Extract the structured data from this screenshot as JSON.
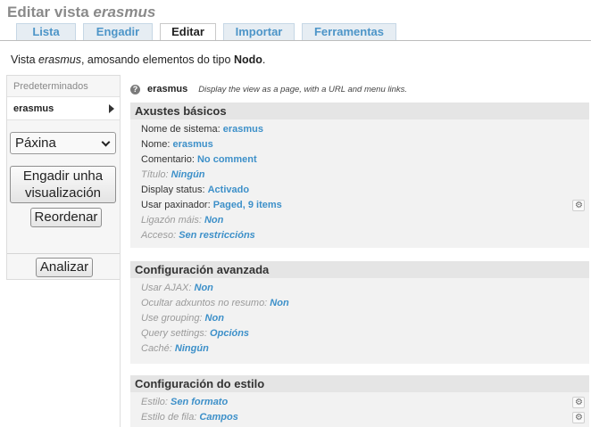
{
  "header": {
    "title_prefix": "Editar vista ",
    "title_view": "erasmus"
  },
  "tabs": [
    {
      "label": "Lista",
      "active": false
    },
    {
      "label": "Engadir",
      "active": false
    },
    {
      "label": "Editar",
      "active": true
    },
    {
      "label": "Importar",
      "active": false
    },
    {
      "label": "Ferramentas",
      "active": false
    }
  ],
  "description": {
    "prefix": "Vista ",
    "view": "erasmus",
    "middle": ", amosando elementos do tipo ",
    "type": "Nodo",
    "suffix": "."
  },
  "sidebar": {
    "tabs": [
      "Predeterminados",
      "erasmus"
    ],
    "display_select": "Páxina",
    "add_button": "Engadir unha visualización",
    "reorder_button": "Reordenar",
    "analyze_button": "Analizar"
  },
  "view_header": {
    "name": "erasmus",
    "desc": "Display the view as a page, with a URL and menu links."
  },
  "sections": {
    "basic": {
      "title": "Axustes básicos",
      "rows": [
        {
          "label": "Nome de sistema: ",
          "value": "erasmus"
        },
        {
          "label": "Nome: ",
          "value": "erasmus"
        },
        {
          "label": "Comentario: ",
          "value": "No comment"
        },
        {
          "label": "Título: ",
          "value": "Ningún"
        },
        {
          "label": "Display status: ",
          "value": "Activado"
        },
        {
          "label": "Usar paxinador: ",
          "value": "Paged, 9 items"
        },
        {
          "label": "Ligazón máis: ",
          "value": "Non"
        },
        {
          "label": "Acceso: ",
          "value": "Sen restriccións"
        }
      ]
    },
    "advanced": {
      "title": "Configuración avanzada",
      "rows": [
        {
          "label": "Usar AJAX: ",
          "value": "Non"
        },
        {
          "label": "Ocultar adxuntos no resumo: ",
          "value": "Non"
        },
        {
          "label": "Use grouping: ",
          "value": "Non"
        },
        {
          "label": "Query settings: ",
          "value": "Opcións"
        },
        {
          "label": "Caché: ",
          "value": "Ningún"
        }
      ]
    },
    "style": {
      "title": "Configuración do estilo",
      "rows": [
        {
          "label": "Estilo: ",
          "value": "Sen formato"
        },
        {
          "label": "Estilo de fila: ",
          "value": "Campos"
        }
      ]
    }
  },
  "icons": {
    "gear": "⚙",
    "help": "?"
  }
}
